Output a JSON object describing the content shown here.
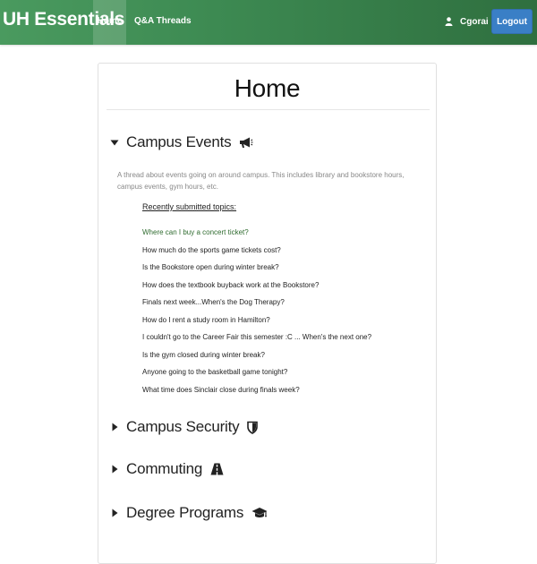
{
  "nav": {
    "brand": "UH Essentials",
    "home": "Home",
    "qa_threads": "Q&A Threads",
    "user": "Cgorai",
    "logout": "Logout"
  },
  "page": {
    "title": "Home"
  },
  "sections": [
    {
      "label": "Campus Events",
      "icon": "megaphone-icon",
      "expanded": true
    },
    {
      "label": "Campus Security",
      "icon": "shield-icon",
      "expanded": false
    },
    {
      "label": "Commuting",
      "icon": "road-icon",
      "expanded": false
    },
    {
      "label": "Degree Programs",
      "icon": "graduation-cap-icon",
      "expanded": false
    }
  ],
  "campus_events": {
    "description": "A thread about events going on around campus. This includes library and bookstore hours, campus events, gym hours, etc.",
    "topics_heading": "Recently submitted topics:",
    "topics": [
      "Where can I buy a concert ticket?",
      "How much do the sports game tickets cost?",
      "Is the Bookstore open during winter break?",
      "How does the textbook buyback work at the Bookstore?",
      "Finals next week...When's the Dog Therapy?",
      "How do I rent a study room in Hamilton?",
      "I couldn't go to the Career Fair this semester :C ... When's the next one?",
      "Is the gym closed during winter break?",
      "Anyone going to the basketball game tonight?",
      "What time does Sinclair close during finals week?"
    ]
  },
  "colors": {
    "navbar_start": "#4a9a5f",
    "navbar_end": "#2f6f3f",
    "logout_button": "#3a7fc6",
    "active_topic": "#2f6b2f"
  }
}
